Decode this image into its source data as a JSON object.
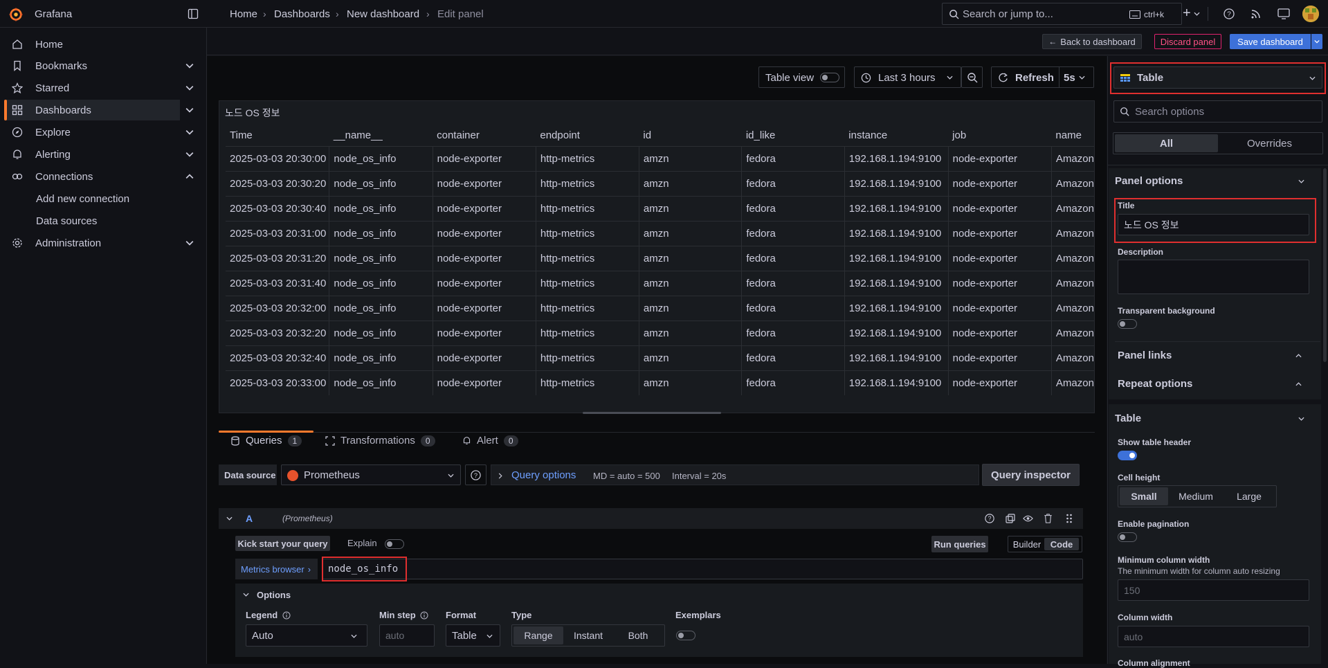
{
  "app": {
    "name": "Grafana"
  },
  "breadcrumb": [
    "Home",
    "Dashboards",
    "New dashboard",
    "Edit panel"
  ],
  "search": {
    "placeholder": "Search or jump to...",
    "shortcut": "ctrl+k"
  },
  "subbar": {
    "back": "Back to dashboard",
    "discard": "Discard panel",
    "save": "Save dashboard"
  },
  "sidebar": {
    "items": [
      {
        "label": "Home",
        "icon": "home-icon"
      },
      {
        "label": "Bookmarks",
        "icon": "bookmark-icon"
      },
      {
        "label": "Starred",
        "icon": "star-icon"
      },
      {
        "label": "Dashboards",
        "icon": "dashboards-icon"
      },
      {
        "label": "Explore",
        "icon": "compass-icon"
      },
      {
        "label": "Alerting",
        "icon": "bell-icon"
      },
      {
        "label": "Connections",
        "icon": "connections-icon"
      },
      {
        "label": "Administration",
        "icon": "gear-icon"
      }
    ],
    "sub_items": [
      "Add new connection",
      "Data sources"
    ]
  },
  "toolbar": {
    "table_view": "Table view",
    "time_range": "Last 3 hours",
    "refresh": "Refresh",
    "interval": "5s"
  },
  "panel": {
    "title": "노드 OS 정보",
    "columns": [
      "Time",
      "__name__",
      "container",
      "endpoint",
      "id",
      "id_like",
      "instance",
      "job",
      "name"
    ],
    "rows": [
      [
        "2025-03-03 20:30:00",
        "node_os_info",
        "node-exporter",
        "http-metrics",
        "amzn",
        "fedora",
        "192.168.1.194:9100",
        "node-exporter",
        "Amazon"
      ],
      [
        "2025-03-03 20:30:20",
        "node_os_info",
        "node-exporter",
        "http-metrics",
        "amzn",
        "fedora",
        "192.168.1.194:9100",
        "node-exporter",
        "Amazon"
      ],
      [
        "2025-03-03 20:30:40",
        "node_os_info",
        "node-exporter",
        "http-metrics",
        "amzn",
        "fedora",
        "192.168.1.194:9100",
        "node-exporter",
        "Amazon"
      ],
      [
        "2025-03-03 20:31:00",
        "node_os_info",
        "node-exporter",
        "http-metrics",
        "amzn",
        "fedora",
        "192.168.1.194:9100",
        "node-exporter",
        "Amazon"
      ],
      [
        "2025-03-03 20:31:20",
        "node_os_info",
        "node-exporter",
        "http-metrics",
        "amzn",
        "fedora",
        "192.168.1.194:9100",
        "node-exporter",
        "Amazon"
      ],
      [
        "2025-03-03 20:31:40",
        "node_os_info",
        "node-exporter",
        "http-metrics",
        "amzn",
        "fedora",
        "192.168.1.194:9100",
        "node-exporter",
        "Amazon"
      ],
      [
        "2025-03-03 20:32:00",
        "node_os_info",
        "node-exporter",
        "http-metrics",
        "amzn",
        "fedora",
        "192.168.1.194:9100",
        "node-exporter",
        "Amazon"
      ],
      [
        "2025-03-03 20:32:20",
        "node_os_info",
        "node-exporter",
        "http-metrics",
        "amzn",
        "fedora",
        "192.168.1.194:9100",
        "node-exporter",
        "Amazon"
      ],
      [
        "2025-03-03 20:32:40",
        "node_os_info",
        "node-exporter",
        "http-metrics",
        "amzn",
        "fedora",
        "192.168.1.194:9100",
        "node-exporter",
        "Amazon"
      ],
      [
        "2025-03-03 20:33:00",
        "node_os_info",
        "node-exporter",
        "http-metrics",
        "amzn",
        "fedora",
        "192.168.1.194:9100",
        "node-exporter",
        "Amazon"
      ]
    ]
  },
  "query_tabs": [
    {
      "label": "Queries",
      "count": "1"
    },
    {
      "label": "Transformations",
      "count": "0"
    },
    {
      "label": "Alert",
      "count": "0"
    }
  ],
  "query": {
    "datasource_label": "Data source",
    "datasource": "Prometheus",
    "query_options": "Query options",
    "md": "MD = auto = 500",
    "interval": "Interval = 20s",
    "inspector": "Query inspector",
    "ref_id": "A",
    "ref_source": "(Prometheus)",
    "kickstart": "Kick start your query",
    "explain": "Explain",
    "run": "Run queries",
    "builder": "Builder",
    "code": "Code",
    "metrics_browser": "Metrics browser",
    "expr": "node_os_info",
    "options": "Options",
    "legend_label": "Legend",
    "legend_value": "Auto",
    "minstep_label": "Min step",
    "minstep_placeholder": "auto",
    "format_label": "Format",
    "format_value": "Table",
    "type_label": "Type",
    "type_options": [
      "Range",
      "Instant",
      "Both"
    ],
    "exemplars_label": "Exemplars"
  },
  "options_pane": {
    "viz": "Table",
    "search_placeholder": "Search options",
    "tabs": [
      "All",
      "Overrides"
    ],
    "panel_options": "Panel options",
    "title_label": "Title",
    "title_value": "노드 OS 정보",
    "description_label": "Description",
    "transparent_label": "Transparent background",
    "panel_links": "Panel links",
    "repeat_options": "Repeat options",
    "table_section": "Table",
    "show_header_label": "Show table header",
    "cell_height_label": "Cell height",
    "cell_height_options": [
      "Small",
      "Medium",
      "Large"
    ],
    "pagination_label": "Enable pagination",
    "min_col_width_label": "Minimum column width",
    "min_col_width_desc": "The minimum width for column auto resizing",
    "min_col_width_placeholder": "150",
    "col_width_label": "Column width",
    "col_width_placeholder": "auto",
    "col_align_label": "Column alignment"
  },
  "colors": {
    "accent": "#3d71d9",
    "brand": "#ff7a2d",
    "discard": "#e0226e",
    "highlight": "#e02f2f"
  }
}
